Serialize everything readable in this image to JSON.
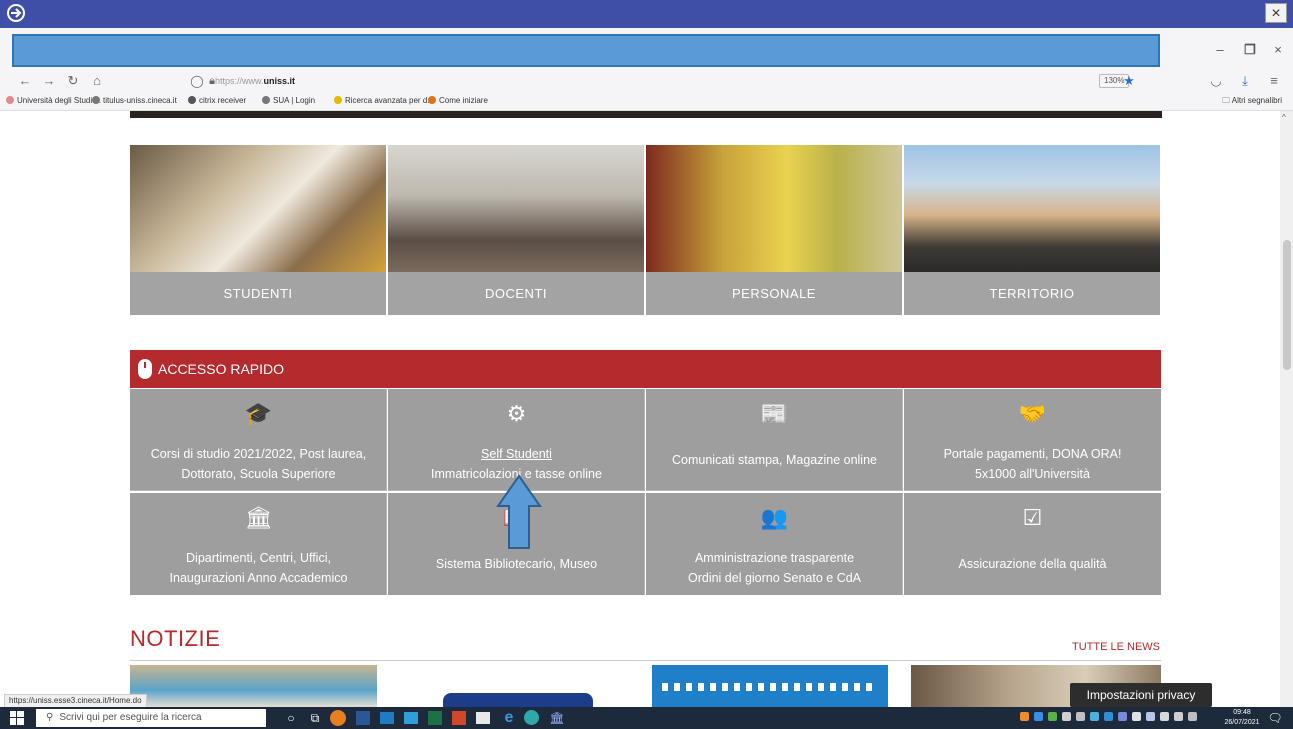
{
  "browser": {
    "close_glyph": "×",
    "url_prefix": "https://www.",
    "url_domain": "uniss.it",
    "zoom": "130%",
    "nav_icons": [
      "back-icon",
      "forward-icon",
      "reload-icon",
      "home-icon"
    ],
    "bookmarks": [
      {
        "label": "Università degli Studi ...",
        "color": "#e08a8a"
      },
      {
        "label": "titulus-uniss.cineca.it",
        "color": "#777777"
      },
      {
        "label": "citrix receiver",
        "color": "#555555"
      },
      {
        "label": "SUA | Login",
        "color": "#777777"
      },
      {
        "label": "Ricerca avanzata per d...",
        "color": "#e6b800"
      },
      {
        "label": "Come iniziare",
        "color": "#e0701a"
      }
    ],
    "other_bookmarks": "Altri segnalibri",
    "status_url": "https://uniss.esse3.cineca.it/Home.do"
  },
  "categories": [
    {
      "label": "STUDENTI"
    },
    {
      "label": "DOCENTI"
    },
    {
      "label": "PERSONALE"
    },
    {
      "label": "TERRITORIO"
    }
  ],
  "rapido": {
    "title": "ACCESSO RAPIDO",
    "cells": [
      {
        "icon": "graduation-cap-icon",
        "glyph": "🎓",
        "line1": "Corsi di studio 2021/2022, Post laurea,",
        "line2": "Dottorato, Scuola Superiore"
      },
      {
        "icon": "gear-icon",
        "glyph": "⚙",
        "line1": "Self Studenti",
        "line2": "Immatricolazioni e tasse online"
      },
      {
        "icon": "newspaper-icon",
        "glyph": "📰",
        "line1": "Comunicati stampa, Magazine online",
        "line2": ""
      },
      {
        "icon": "handshake-icon",
        "glyph": "🤝",
        "line1": "Portale pagamenti, DONA ORA!",
        "line2": "5x1000 all'Università"
      },
      {
        "icon": "institution-icon",
        "glyph": "🏛",
        "line1": "Dipartimenti, Centri, Uffici,",
        "line2": "Inaugurazioni Anno Accademico"
      },
      {
        "icon": "book-icon",
        "glyph": "📖",
        "line1": "Sistema Bibliotecario, Museo",
        "line2": ""
      },
      {
        "icon": "users-icon",
        "glyph": "👥",
        "line1": "Amministrazione trasparente",
        "line2": "Ordini del giorno Senato e CdA"
      },
      {
        "icon": "checkbox-icon",
        "glyph": "☑",
        "line1": "Assicurazione della qualità",
        "line2": ""
      }
    ]
  },
  "news": {
    "title": "NOTIZIE",
    "all_link": "TUTTE LE NEWS"
  },
  "privacy_button": "Impostazioni privacy",
  "taskbar": {
    "search_placeholder": "Scrivi qui per eseguire la ricerca",
    "time": "09:48",
    "date": "26/07/2021"
  }
}
